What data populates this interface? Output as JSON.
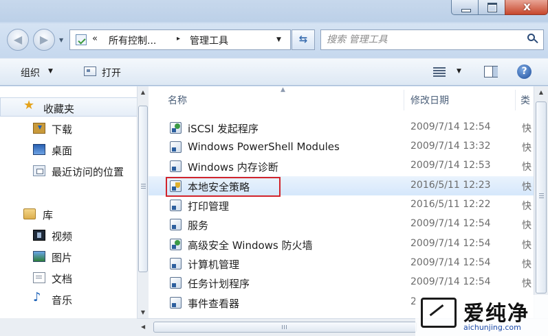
{
  "window": {
    "close_label": "x"
  },
  "address_bar": {
    "overflow": "«",
    "crumbs": [
      "所有控制...",
      "管理工具"
    ],
    "separator": "▸"
  },
  "search": {
    "placeholder": "搜索 管理工具"
  },
  "toolbar": {
    "organize_label": "组织",
    "open_label": "打开",
    "help_label": "?"
  },
  "nav_pane": {
    "favorites": {
      "label": "收藏夹",
      "icon": "star-icon"
    },
    "favorite_items": [
      {
        "label": "下载",
        "icon": "downloads-icon"
      },
      {
        "label": "桌面",
        "icon": "desktop-icon"
      },
      {
        "label": "最近访问的位置",
        "icon": "recent-places-icon"
      }
    ],
    "libraries": {
      "label": "库",
      "icon": "libraries-icon"
    },
    "library_items": [
      {
        "label": "视频",
        "icon": "videos-icon"
      },
      {
        "label": "图片",
        "icon": "pictures-icon"
      },
      {
        "label": "文档",
        "icon": "documents-icon"
      },
      {
        "label": "音乐",
        "icon": "music-icon"
      }
    ]
  },
  "file_list": {
    "columns": {
      "name": "名称",
      "date": "修改日期",
      "type": "类"
    },
    "files": [
      {
        "name": "iSCSI 发起程序",
        "date": "2009/7/14 12:54",
        "type": "快"
      },
      {
        "name": "Windows PowerShell Modules",
        "date": "2009/7/14 13:32",
        "type": "快"
      },
      {
        "name": "Windows 内存诊断",
        "date": "2009/7/14 12:53",
        "type": "快"
      },
      {
        "name": "本地安全策略",
        "date": "2016/5/11 12:23",
        "type": "快"
      },
      {
        "name": "打印管理",
        "date": "2016/5/11 12:22",
        "type": "快"
      },
      {
        "name": "服务",
        "date": "2009/7/14 12:54",
        "type": "快"
      },
      {
        "name": "高级安全 Windows 防火墙",
        "date": "2009/7/14 12:54",
        "type": "快"
      },
      {
        "name": "计算机管理",
        "date": "2009/7/14 12:54",
        "type": "快"
      },
      {
        "name": "任务计划程序",
        "date": "2009/7/14 12:54",
        "type": "快"
      },
      {
        "name": "事件查看器",
        "date": "2",
        "type": ""
      }
    ],
    "selected": "本地安全策略"
  },
  "watermark": {
    "title": "爱纯净",
    "url": "aichunjing.com"
  },
  "colors": {
    "highlight_box": "#d2232a",
    "selection": "#d5e7fb"
  }
}
